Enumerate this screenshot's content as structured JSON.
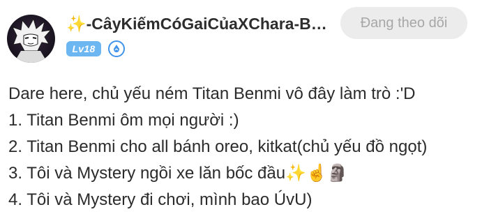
{
  "post": {
    "author": {
      "username": "✨-CâyKiếmCóGaiCủaXChara-Benmi",
      "level_label": "Lv18",
      "avatar_icon": "anime-avatar-icon",
      "title_badge_icon": "title-badge-icon"
    },
    "follow_button_label": "Đang theo dõi",
    "content_lines": [
      "Dare here, chủ yếu ném Titan Benmi vô đây làm trò :'D",
      "1. Titan Benmi ôm mọi người :)",
      "2. Titan Benmi cho all bánh oreo, kitkat(chủ yếu đồ ngọt)",
      "3. Tôi và Mystery ngồi xe lăn bốc đầu✨☝️🗿",
      "4. Tôi và Mystery đi chơi, mình bao ÚvU)"
    ]
  },
  "colors": {
    "level_badge": "#6cb6f2",
    "follow_button_bg": "#ececec",
    "follow_button_text": "#a7a7a7",
    "text": "#2b2b2b"
  }
}
